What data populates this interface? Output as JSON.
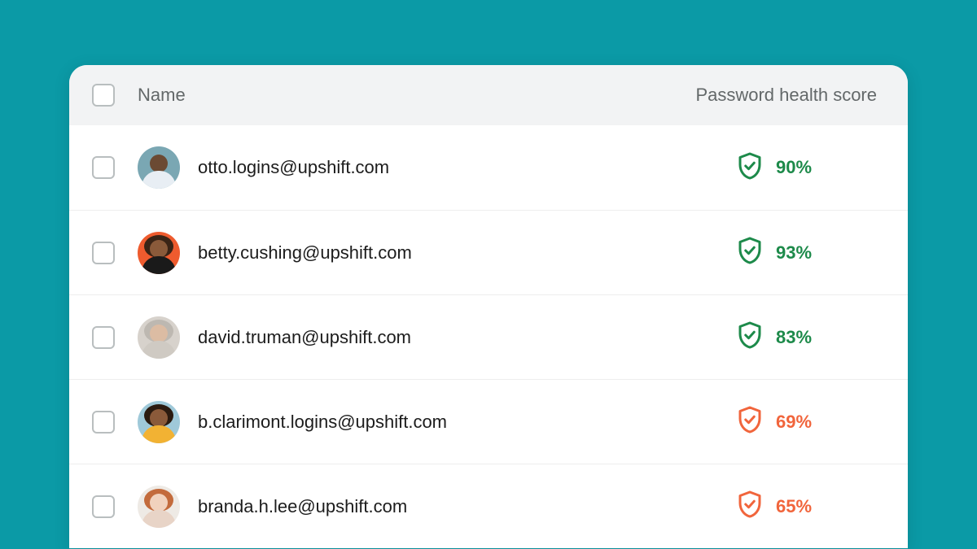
{
  "table": {
    "columns": {
      "name": "Name",
      "score": "Password health score"
    },
    "rows": [
      {
        "email": "otto.logins@upshift.com",
        "score": "90%",
        "status": "green",
        "avatar": {
          "bg": "#7aa7b3",
          "skin": "#6b4a33",
          "shirt": "#e8eef4"
        }
      },
      {
        "email": "betty.cushing@upshift.com",
        "score": "93%",
        "status": "green",
        "avatar": {
          "bg": "#ee5b2e",
          "skin": "#8a5a3a",
          "shirt": "#1a1a1a",
          "hair": "#3a2416"
        }
      },
      {
        "email": "david.truman@upshift.com",
        "score": "83%",
        "status": "green",
        "avatar": {
          "bg": "#d7d2cc",
          "skin": "#dcbca3",
          "shirt": "#cfcac3",
          "hair": "#bdb8b1"
        }
      },
      {
        "email": "b.clarimont.logins@upshift.com",
        "score": "69%",
        "status": "orange",
        "avatar": {
          "bg": "#9fc9d9",
          "skin": "#8a5a3a",
          "shirt": "#f2b233",
          "hair": "#2b1b10"
        }
      },
      {
        "email": "branda.h.lee@upshift.com",
        "score": "65%",
        "status": "orange",
        "avatar": {
          "bg": "#eeeae5",
          "skin": "#f1d2bd",
          "shirt": "#e8d4c7",
          "hair": "#c36b3c"
        }
      }
    ]
  },
  "colors": {
    "green": "#1d8a4a",
    "orange": "#f1653c"
  }
}
